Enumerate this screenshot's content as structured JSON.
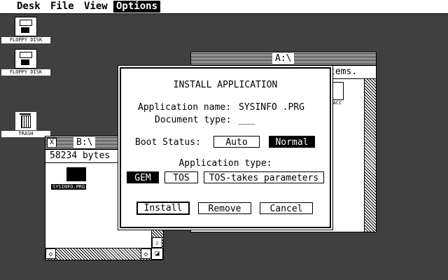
{
  "menubar": {
    "items": [
      {
        "label": "Desk"
      },
      {
        "label": "File"
      },
      {
        "label": "View"
      },
      {
        "label": "Options"
      }
    ],
    "active": "Options"
  },
  "desktop": {
    "icons": [
      {
        "label": "FLOPPY DISK",
        "icon": "floppy-disk-icon"
      },
      {
        "label": "FLOPPY DISK",
        "icon": "floppy-disk-icon"
      },
      {
        "label": "TRASH",
        "icon": "trash-icon"
      }
    ]
  },
  "window_a": {
    "title": "A:\\",
    "info_fragment": "tems.",
    "file_label_fragment": "OL.ACC"
  },
  "window_b": {
    "title": "B:\\",
    "info": "58234 bytes",
    "file": {
      "label": "SYSINFO.PRG",
      "icon": "program-file-icon"
    },
    "close_glyph": "X",
    "down_arrow": "⇩",
    "left_arrow": "◇",
    "right_arrow": "◇",
    "resize_glyph": "◪"
  },
  "dialog": {
    "title": "INSTALL APPLICATION",
    "app_name_label": "Application name:",
    "app_name_value": "SYSINFO .PRG",
    "doc_type_label": "Document type:",
    "doc_type_value": "___",
    "boot_status_label": "Boot Status:",
    "boot_options": [
      {
        "label": "Auto",
        "selected": false
      },
      {
        "label": "Normal",
        "selected": true
      }
    ],
    "app_type_label": "Application type:",
    "app_types": [
      {
        "label": "GEM",
        "selected": true
      },
      {
        "label": "TOS",
        "selected": false
      },
      {
        "label": "TOS-takes parameters",
        "selected": false
      }
    ],
    "buttons": {
      "install": "Install",
      "remove": "Remove",
      "cancel": "Cancel"
    }
  }
}
